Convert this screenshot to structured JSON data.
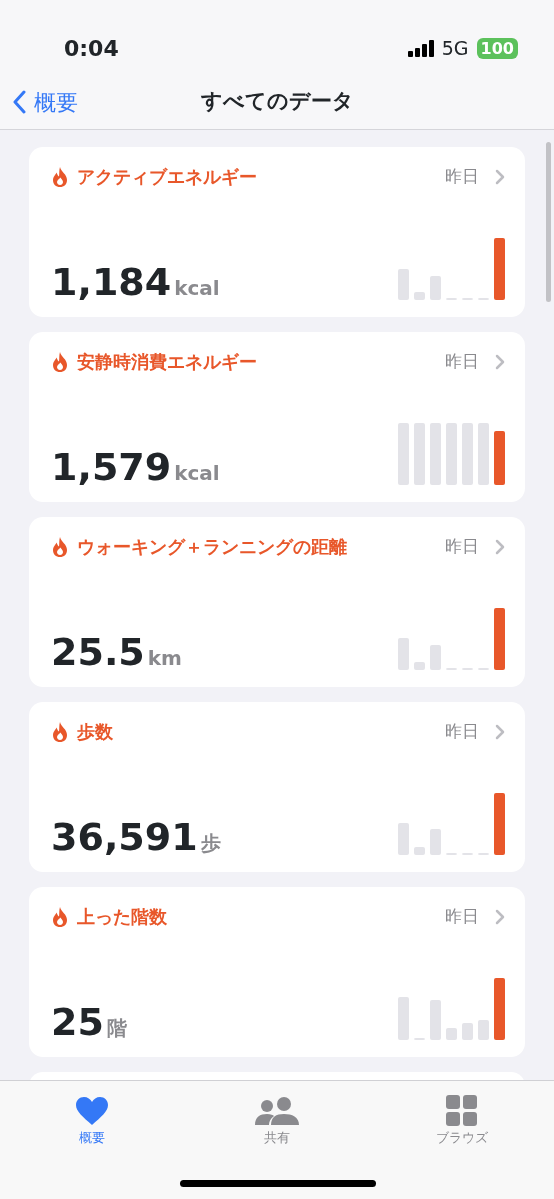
{
  "status_bar": {
    "time": "0:04",
    "network": "5G",
    "battery": "100"
  },
  "nav": {
    "back": "概要",
    "title": "すべてのデータ"
  },
  "cards": [
    {
      "title": "アクティブエネルギー",
      "date": "昨日",
      "value": "1,184",
      "unit": "kcal"
    },
    {
      "title": "安静時消費エネルギー",
      "date": "昨日",
      "value": "1,579",
      "unit": "kcal"
    },
    {
      "title": "ウォーキング＋ランニングの距離",
      "date": "昨日",
      "value": "25.5",
      "unit": "km"
    },
    {
      "title": "歩数",
      "date": "昨日",
      "value": "36,591",
      "unit": "歩"
    },
    {
      "title": "上った階数",
      "date": "昨日",
      "value": "25",
      "unit": "階"
    }
  ],
  "tabs": [
    {
      "label": "概要",
      "kind": "heart",
      "selected": true
    },
    {
      "label": "共有",
      "kind": "people",
      "selected": false
    },
    {
      "label": "ブラウズ",
      "kind": "grid",
      "selected": false
    }
  ]
}
